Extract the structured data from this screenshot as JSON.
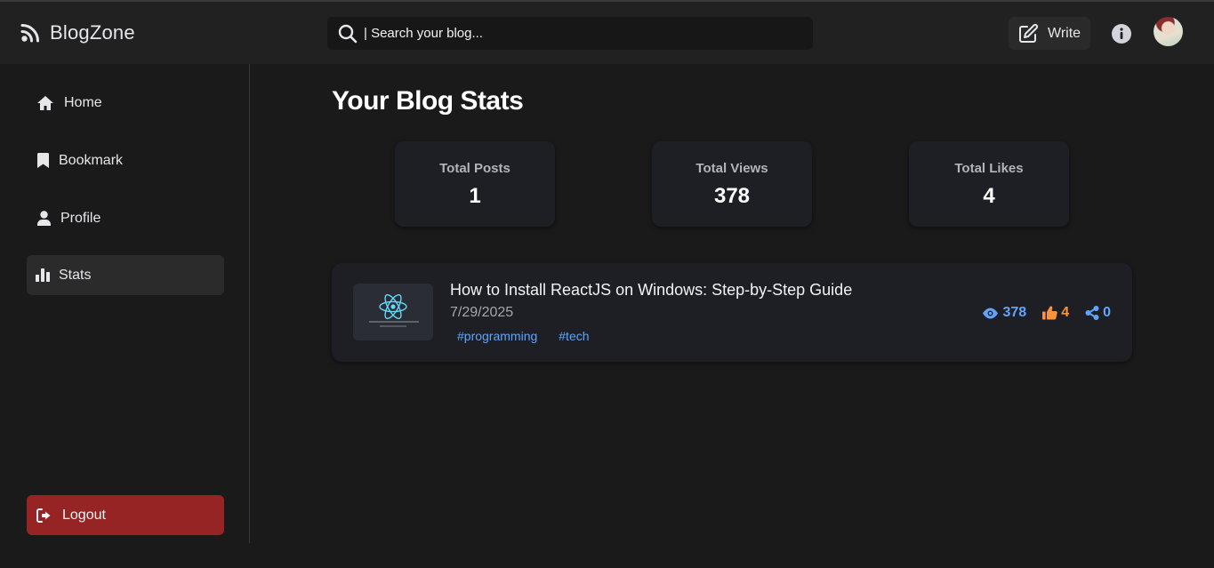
{
  "app": {
    "name": "BlogZone"
  },
  "search": {
    "placeholder": "| Search your blog..."
  },
  "header": {
    "write_label": "Write"
  },
  "sidebar": {
    "items": [
      {
        "label": "Home",
        "icon": "home-icon"
      },
      {
        "label": "Bookmark",
        "icon": "bookmark-icon"
      },
      {
        "label": "Profile",
        "icon": "user-icon"
      },
      {
        "label": "Stats",
        "icon": "bar-chart-icon",
        "active": true
      }
    ],
    "logout_label": "Logout"
  },
  "main": {
    "title": "Your Blog Stats",
    "stats": [
      {
        "label": "Total Posts",
        "value": "1"
      },
      {
        "label": "Total Views",
        "value": "378"
      },
      {
        "label": "Total Likes",
        "value": "4"
      }
    ],
    "posts": [
      {
        "title": "How to Install ReactJS on Windows: Step-by-Step Guide",
        "date": "7/29/2025",
        "tags": [
          "#programming",
          "#tech"
        ],
        "views": "378",
        "likes": "4",
        "shares": "0"
      }
    ]
  },
  "colors": {
    "background": "#1a1a1a",
    "header": "#212121",
    "card": "#1d1f24",
    "accent_blue": "#60a5fa",
    "accent_orange": "#fb923c",
    "logout": "#962424"
  }
}
